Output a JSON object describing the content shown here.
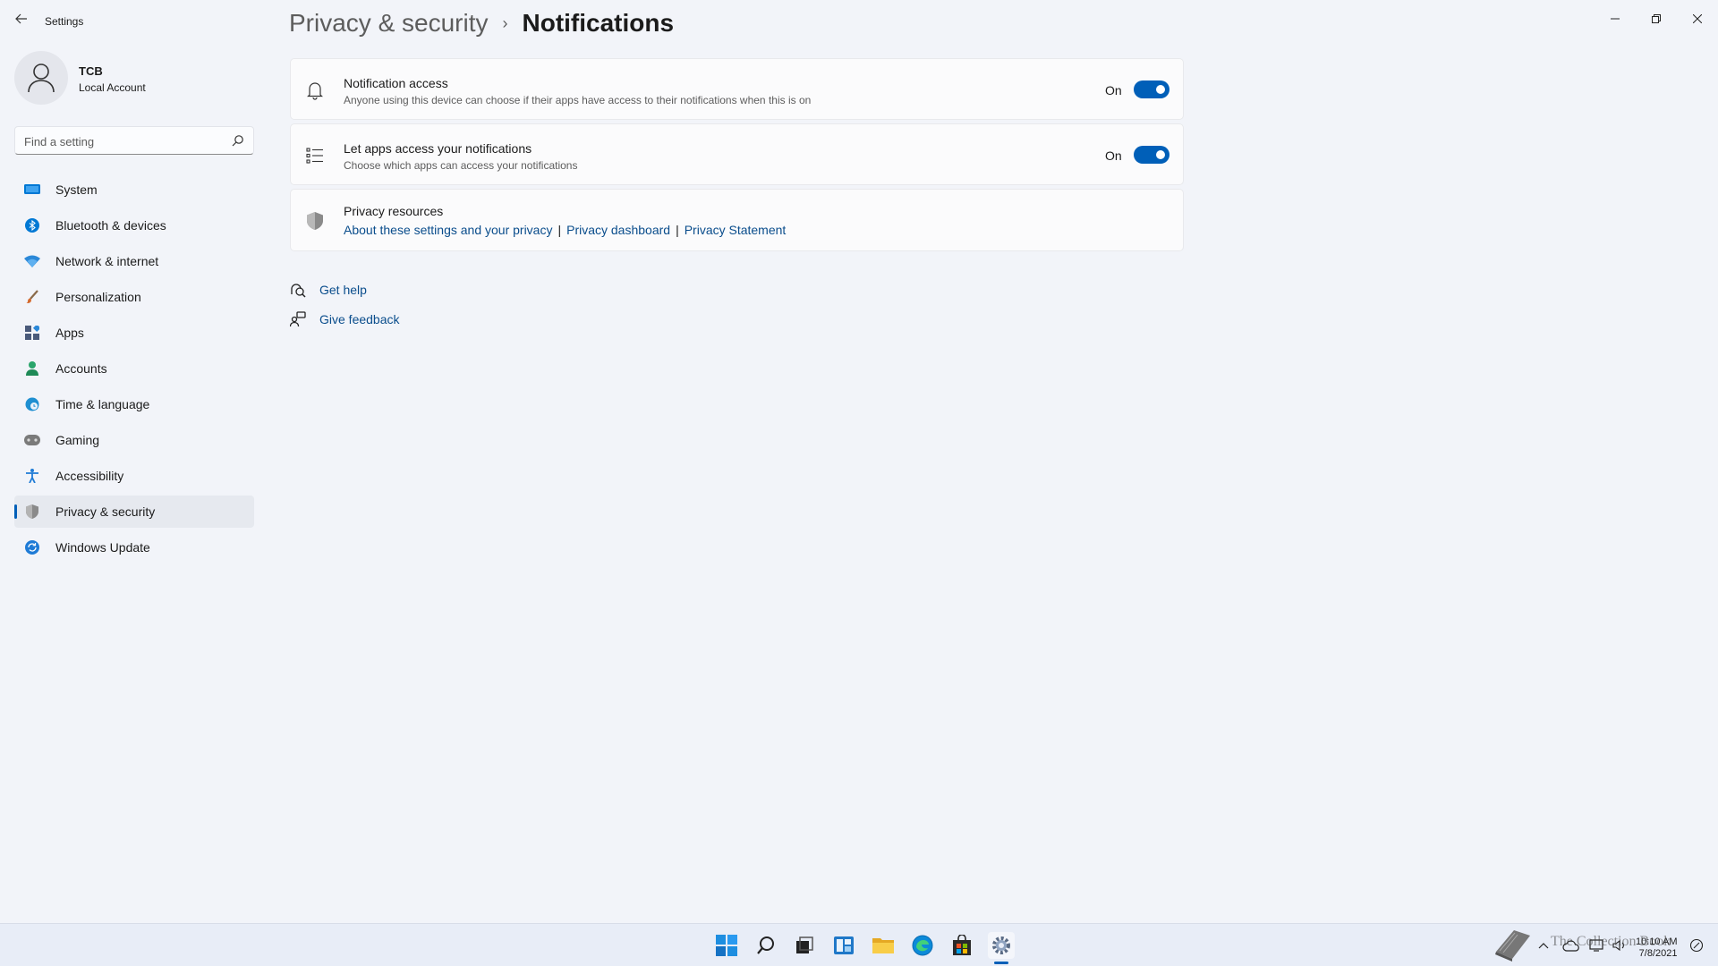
{
  "window": {
    "app_title": "Settings"
  },
  "profile": {
    "name": "TCB",
    "account_type": "Local Account"
  },
  "search": {
    "placeholder": "Find a setting",
    "value": ""
  },
  "nav": {
    "items": [
      {
        "label": "System",
        "icon": "system-icon",
        "color": "#0078d4"
      },
      {
        "label": "Bluetooth & devices",
        "icon": "bluetooth-icon",
        "color": "#0078d4"
      },
      {
        "label": "Network & internet",
        "icon": "wifi-icon",
        "color": "#2b88d8"
      },
      {
        "label": "Personalization",
        "icon": "brush-icon",
        "color": "#d46a2e"
      },
      {
        "label": "Apps",
        "icon": "apps-icon",
        "color": "#4a5a7a"
      },
      {
        "label": "Accounts",
        "icon": "person-icon",
        "color": "#2aa56b"
      },
      {
        "label": "Time & language",
        "icon": "globe-clock-icon",
        "color": "#1f8fd1"
      },
      {
        "label": "Gaming",
        "icon": "controller-icon",
        "color": "#6b6b6b"
      },
      {
        "label": "Accessibility",
        "icon": "accessibility-icon",
        "color": "#1f7bd6"
      },
      {
        "label": "Privacy & security",
        "icon": "shield-icon",
        "color": "#7d7d7d",
        "selected": true
      },
      {
        "label": "Windows Update",
        "icon": "update-icon",
        "color": "#1f7bd6"
      }
    ]
  },
  "breadcrumb": {
    "parent": "Privacy & security",
    "separator": "›",
    "current": "Notifications"
  },
  "cards": {
    "notification_access": {
      "title": "Notification access",
      "description": "Anyone using this device can choose if their apps have access to their notifications when this is on",
      "state_label": "On",
      "enabled": true
    },
    "let_apps_access": {
      "title": "Let apps access your notifications",
      "description": "Choose which apps can access your notifications",
      "state_label": "On",
      "enabled": true
    },
    "privacy_resources": {
      "title": "Privacy resources",
      "links": [
        "About these settings and your privacy",
        "Privacy dashboard",
        "Privacy Statement"
      ],
      "separator": "|"
    }
  },
  "help": {
    "get_help": "Get help",
    "give_feedback": "Give feedback"
  },
  "taskbar": {
    "apps": [
      "start-icon",
      "search-icon",
      "task-view-icon",
      "widgets-icon",
      "file-explorer-icon",
      "edge-icon",
      "store-icon",
      "settings-icon"
    ],
    "clock_time": "10:10 AM",
    "clock_date": "7/8/2021",
    "watermark_text": "The Collection Book"
  },
  "colors": {
    "accent": "#005fb8",
    "link": "#0a4d8c",
    "background": "#f2f4f9",
    "card": "#fbfbfc"
  }
}
